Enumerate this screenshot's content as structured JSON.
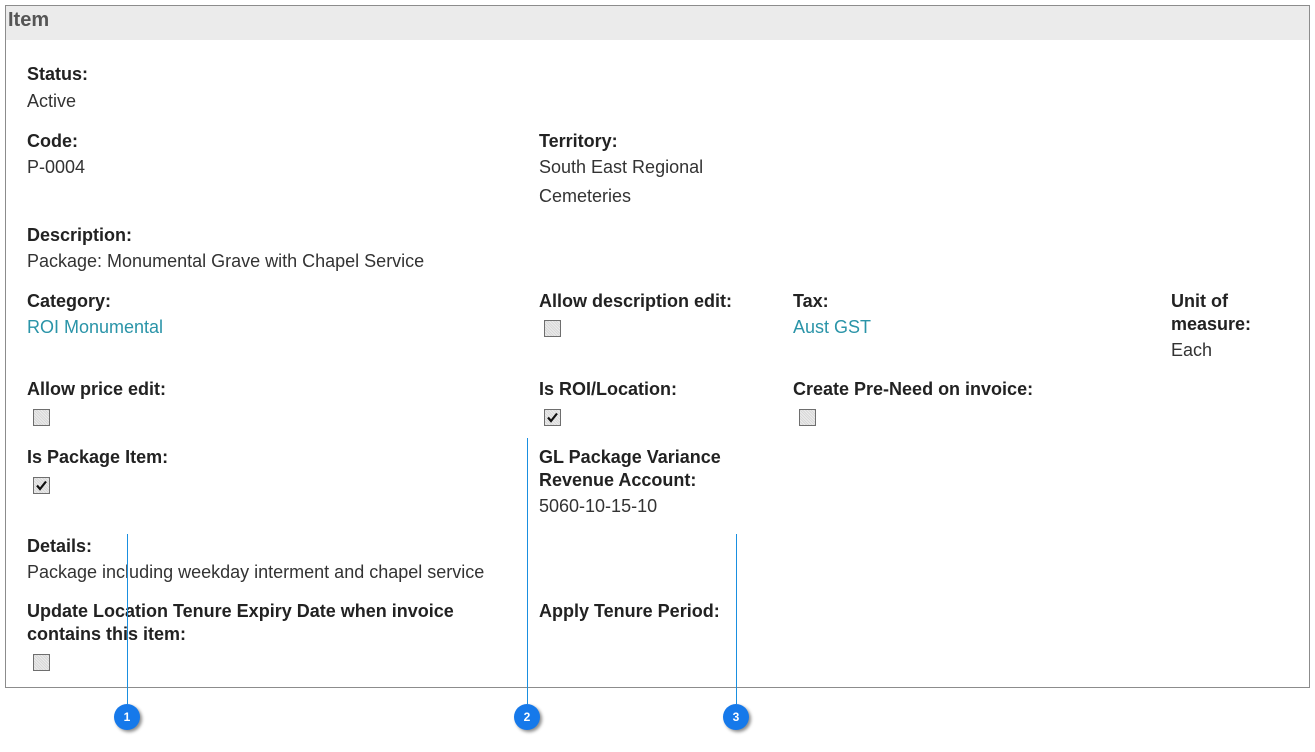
{
  "panel": {
    "title": "Item"
  },
  "fields": {
    "status": {
      "label": "Status:",
      "value": "Active"
    },
    "code": {
      "label": "Code:",
      "value": "P-0004"
    },
    "territory": {
      "label": "Territory:",
      "value": "South East Regional Cemeteries"
    },
    "description": {
      "label": "Description:",
      "value": "Package: Monumental Grave with Chapel Service"
    },
    "category": {
      "label": "Category:",
      "value": "ROI Monumental"
    },
    "allow_description_edit": {
      "label": "Allow description edit:",
      "checked": false
    },
    "tax": {
      "label": "Tax:",
      "value": "Aust GST"
    },
    "unit_of_measure": {
      "label": "Unit of measure:",
      "value": "Each"
    },
    "allow_price_edit": {
      "label": "Allow price edit:",
      "checked": false
    },
    "is_roi_location": {
      "label": "Is ROI/Location:",
      "checked": true
    },
    "create_pre_need": {
      "label": "Create Pre-Need on invoice:",
      "checked": false
    },
    "is_package_item": {
      "label": "Is Package Item:",
      "checked": true
    },
    "gl_package_variance": {
      "label": "GL Package Variance Revenue Account:",
      "value": "5060-10-15-10"
    },
    "details": {
      "label": "Details:",
      "value": "Package including weekday interment and chapel service"
    },
    "update_location_tenure": {
      "label": "Update Location Tenure Expiry Date when invoice contains this item:",
      "checked": false
    },
    "apply_tenure_period": {
      "label": "Apply Tenure Period:"
    }
  },
  "callouts": [
    "1",
    "2",
    "3"
  ],
  "colors": {
    "link": "#2a94a8",
    "callout": "#1679ea",
    "header_bg": "#ebebeb"
  }
}
